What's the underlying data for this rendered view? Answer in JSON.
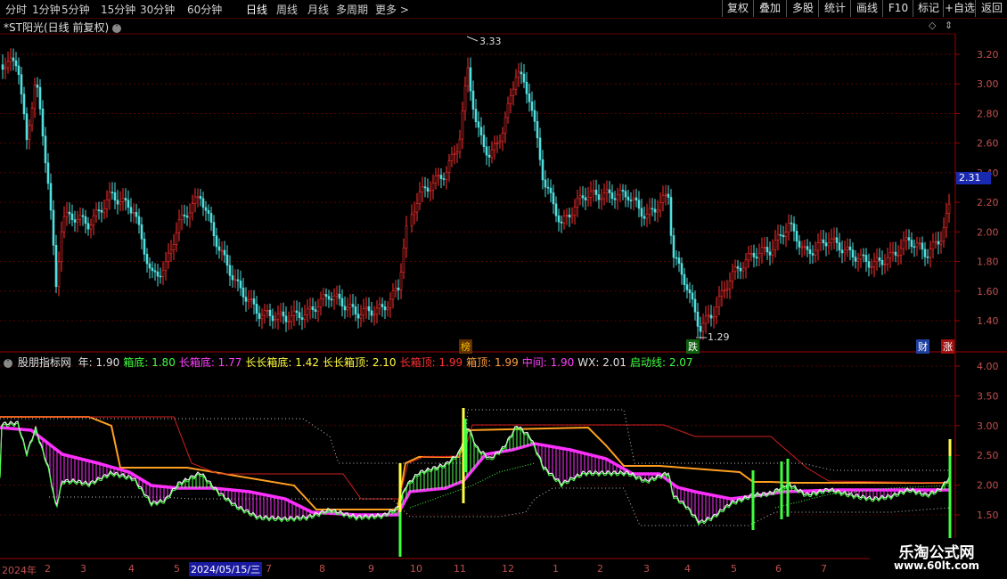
{
  "toolbar": {
    "periods": [
      "分时",
      "1分钟",
      "5分钟",
      "15分钟",
      "30分钟",
      "60分钟",
      "日线",
      "周线",
      "月线",
      "多周期",
      "更多 >"
    ],
    "active_period": "日线",
    "buttons": [
      "复权",
      "叠加",
      "多股",
      "统计",
      "画线",
      "F10",
      "标记",
      "+自选",
      "返回"
    ]
  },
  "main": {
    "title": "*ST阳光(日线 前复权)",
    "price_axis": [
      "3.20",
      "3.00",
      "2.80",
      "2.60",
      "2.40",
      "2.20",
      "2.00",
      "1.80",
      "1.60",
      "1.40"
    ],
    "current_price": "2.31",
    "high_label": "3.33",
    "low_label": "1.29",
    "badges": [
      {
        "text": "榜",
        "color": "#f0c000",
        "bg": "#603000"
      },
      {
        "text": "跌",
        "color": "#fff",
        "bg": "#106010"
      },
      {
        "text": "财",
        "color": "#fff",
        "bg": "#2040a0"
      },
      {
        "text": "涨",
        "color": "#fff",
        "bg": "#a01010"
      }
    ]
  },
  "indicator": {
    "name": "股朋指标网",
    "values": [
      {
        "label": "年: 1.90",
        "color": "#e0e0e0"
      },
      {
        "label": "箱底: 1.80",
        "color": "#40ff40"
      },
      {
        "label": "长箱底: 1.77",
        "color": "#ff40ff"
      },
      {
        "label": "长长箱底: 1.42",
        "color": "#ffff40"
      },
      {
        "label": "长长箱顶: 2.10",
        "color": "#ffff40"
      },
      {
        "label": "长箱顶: 1.99",
        "color": "#ff3030"
      },
      {
        "label": "箱顶: 1.99",
        "color": "#ffa040"
      },
      {
        "label": "中间: 1.90",
        "color": "#ff40ff"
      },
      {
        "label": "WX: 2.01",
        "color": "#e0e0e0"
      },
      {
        "label": "启动线: 2.07",
        "color": "#40ff40"
      }
    ],
    "axis": [
      "4.00",
      "3.50",
      "3.00",
      "2.50",
      "2.00",
      "1.50"
    ]
  },
  "dates": {
    "ticks": [
      "2024年",
      "2",
      "3",
      "4",
      "5",
      "7",
      "8",
      "9",
      "10",
      "11",
      "12",
      "1",
      "2",
      "3",
      "4",
      "5",
      "6",
      "7"
    ],
    "selected": "2024/05/15/三"
  },
  "watermark": {
    "line1": "乐淘公式网",
    "line2": "www.60lt.com"
  },
  "chart_data": {
    "type": "candlestick",
    "price_ylim": [
      1.29,
      3.33
    ],
    "indicator_ylim": [
      1.3,
      4.1
    ]
  }
}
